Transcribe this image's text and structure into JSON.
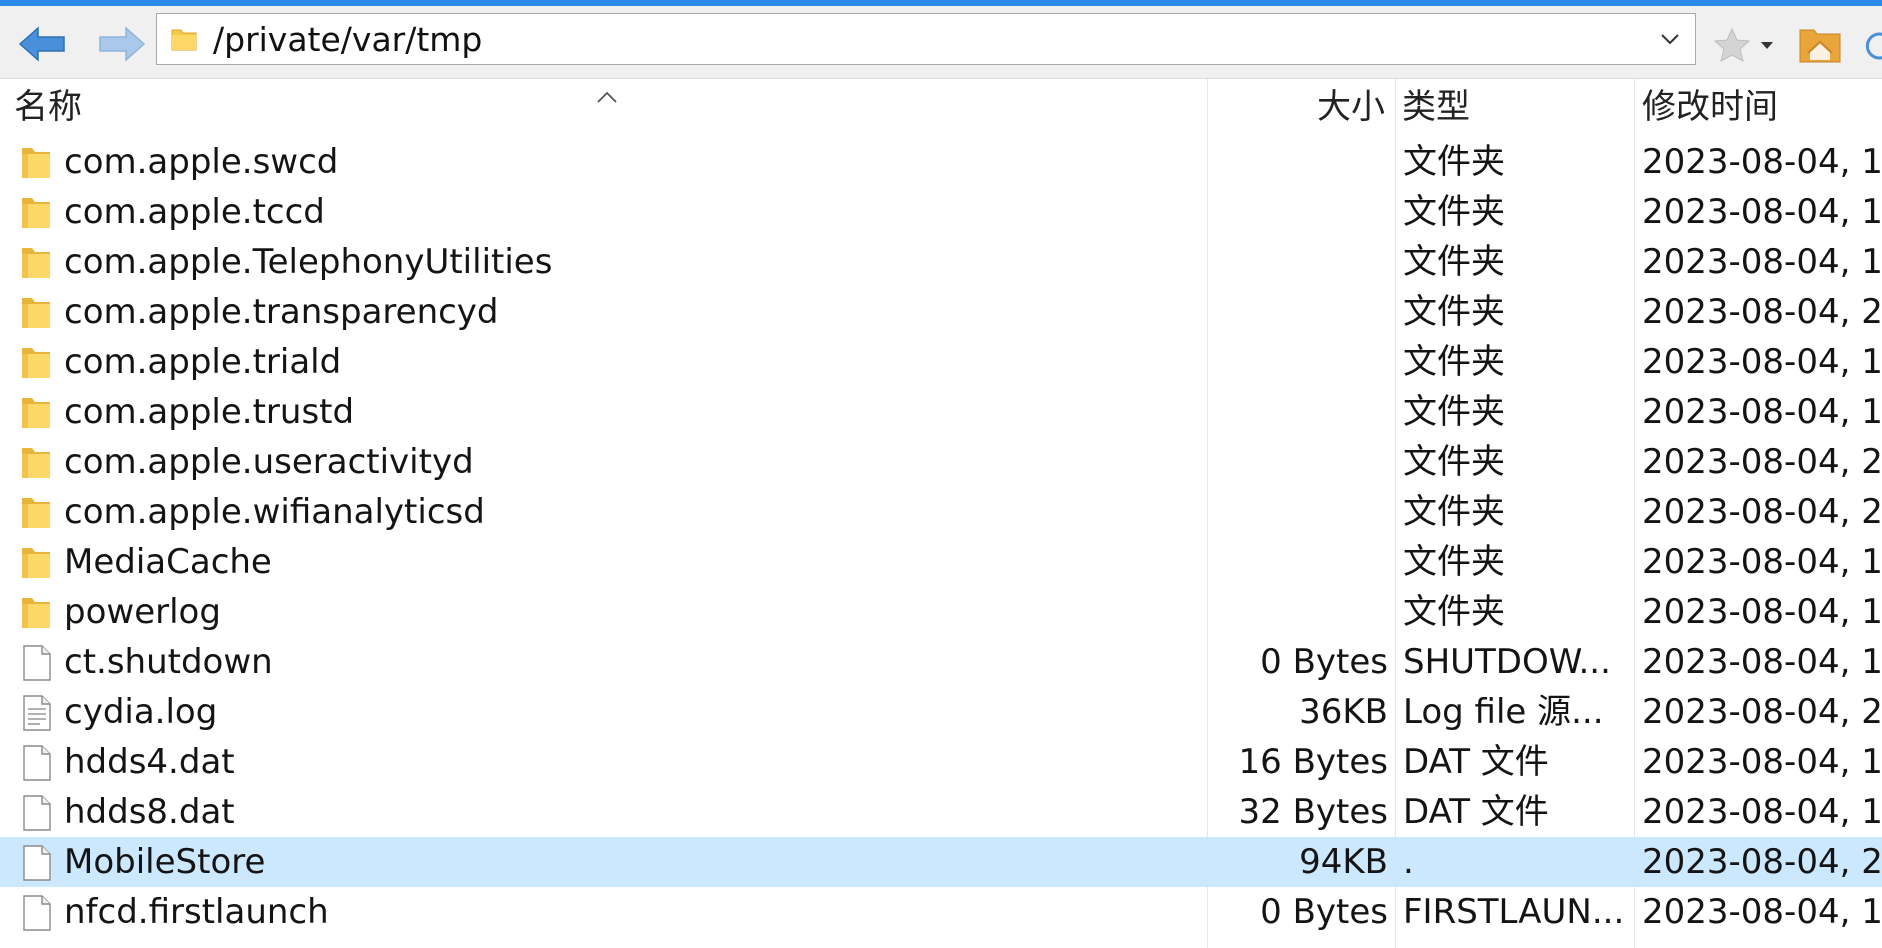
{
  "address": {
    "path": "/private/var/tmp"
  },
  "columns": {
    "name": "名称",
    "size": "大小",
    "type": "类型",
    "modified": "修改时间"
  },
  "files": [
    {
      "name": "com.apple.swcd",
      "size": "",
      "type": "文件夹",
      "modified": "2023-08-04, 1",
      "icon": "folder-icon"
    },
    {
      "name": "com.apple.tccd",
      "size": "",
      "type": "文件夹",
      "modified": "2023-08-04, 1",
      "icon": "folder-icon"
    },
    {
      "name": "com.apple.TelephonyUtilities",
      "size": "",
      "type": "文件夹",
      "modified": "2023-08-04, 1",
      "icon": "folder-icon"
    },
    {
      "name": "com.apple.transparencyd",
      "size": "",
      "type": "文件夹",
      "modified": "2023-08-04, 2",
      "icon": "folder-icon"
    },
    {
      "name": "com.apple.triald",
      "size": "",
      "type": "文件夹",
      "modified": "2023-08-04, 1",
      "icon": "folder-icon"
    },
    {
      "name": "com.apple.trustd",
      "size": "",
      "type": "文件夹",
      "modified": "2023-08-04, 1",
      "icon": "folder-icon"
    },
    {
      "name": "com.apple.useractivityd",
      "size": "",
      "type": "文件夹",
      "modified": "2023-08-04, 2",
      "icon": "folder-icon"
    },
    {
      "name": "com.apple.wifianalyticsd",
      "size": "",
      "type": "文件夹",
      "modified": "2023-08-04, 2",
      "icon": "folder-icon"
    },
    {
      "name": "MediaCache",
      "size": "",
      "type": "文件夹",
      "modified": "2023-08-04, 1",
      "icon": "folder-icon"
    },
    {
      "name": "powerlog",
      "size": "",
      "type": "文件夹",
      "modified": "2023-08-04, 1",
      "icon": "folder-icon"
    },
    {
      "name": "ct.shutdown",
      "size": "0 Bytes",
      "type": "SHUTDOW...",
      "modified": "2023-08-04, 1",
      "icon": "file-icon"
    },
    {
      "name": "cydia.log",
      "size": "36KB",
      "type": "Log file 源...",
      "modified": "2023-08-04, 2",
      "icon": "text-file-icon"
    },
    {
      "name": "hdds4.dat",
      "size": "16 Bytes",
      "type": "DAT 文件",
      "modified": "2023-08-04, 1",
      "icon": "file-icon"
    },
    {
      "name": "hdds8.dat",
      "size": "32 Bytes",
      "type": "DAT 文件",
      "modified": "2023-08-04, 1",
      "icon": "file-icon"
    },
    {
      "name": "MobileStore",
      "size": "94KB",
      "type": ".",
      "modified": "2023-08-04, 2",
      "icon": "file-icon",
      "selected": true
    },
    {
      "name": "nfcd.firstlaunch",
      "size": "0 Bytes",
      "type": "FIRSTLAUN...",
      "modified": "2023-08-04, 1",
      "icon": "file-icon"
    }
  ],
  "colors": {
    "accent": "#2a8be8",
    "selection": "#cce8ff",
    "folder": "#f5c94a"
  }
}
